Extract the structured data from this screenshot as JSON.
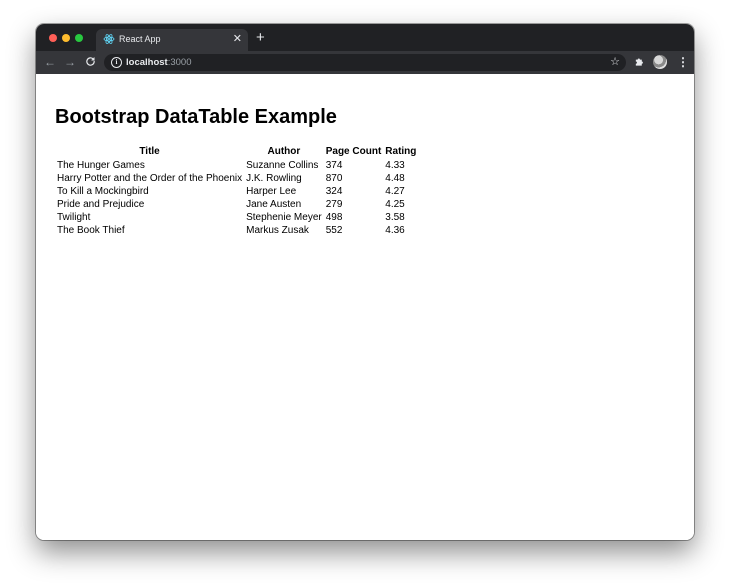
{
  "browser": {
    "tab_title": "React App",
    "url_host": "localhost",
    "url_port": ":3000",
    "colors": {
      "titlebar": "#202124",
      "toolbar": "#35363a",
      "traffic_red": "#ff5f57",
      "traffic_yellow": "#febc2e",
      "traffic_green": "#28c840",
      "react_logo": "#61dafb"
    },
    "icons": {
      "favicon": "react-logo-icon",
      "close": "close-icon",
      "new_tab": "plus-icon",
      "back": "back-arrow-icon",
      "forward": "forward-arrow-icon",
      "reload": "reload-icon",
      "site_info": "info-icon",
      "bookmark": "star-icon",
      "extensions": "puzzle-icon",
      "profile": "avatar",
      "menu": "kebab-menu-icon"
    }
  },
  "page": {
    "title": "Bootstrap DataTable Example"
  },
  "table": {
    "columns": [
      "Title",
      "Author",
      "Page Count",
      "Rating"
    ],
    "rows": [
      [
        "The Hunger Games",
        "Suzanne Collins",
        "374",
        "4.33"
      ],
      [
        "Harry Potter and the Order of the Phoenix",
        "J.K. Rowling",
        "870",
        "4.48"
      ],
      [
        "To Kill a Mockingbird",
        "Harper Lee",
        "324",
        "4.27"
      ],
      [
        "Pride and Prejudice",
        "Jane Austen",
        "279",
        "4.25"
      ],
      [
        "Twilight",
        "Stephenie Meyer",
        "498",
        "3.58"
      ],
      [
        "The Book Thief",
        "Markus Zusak",
        "552",
        "4.36"
      ]
    ]
  }
}
